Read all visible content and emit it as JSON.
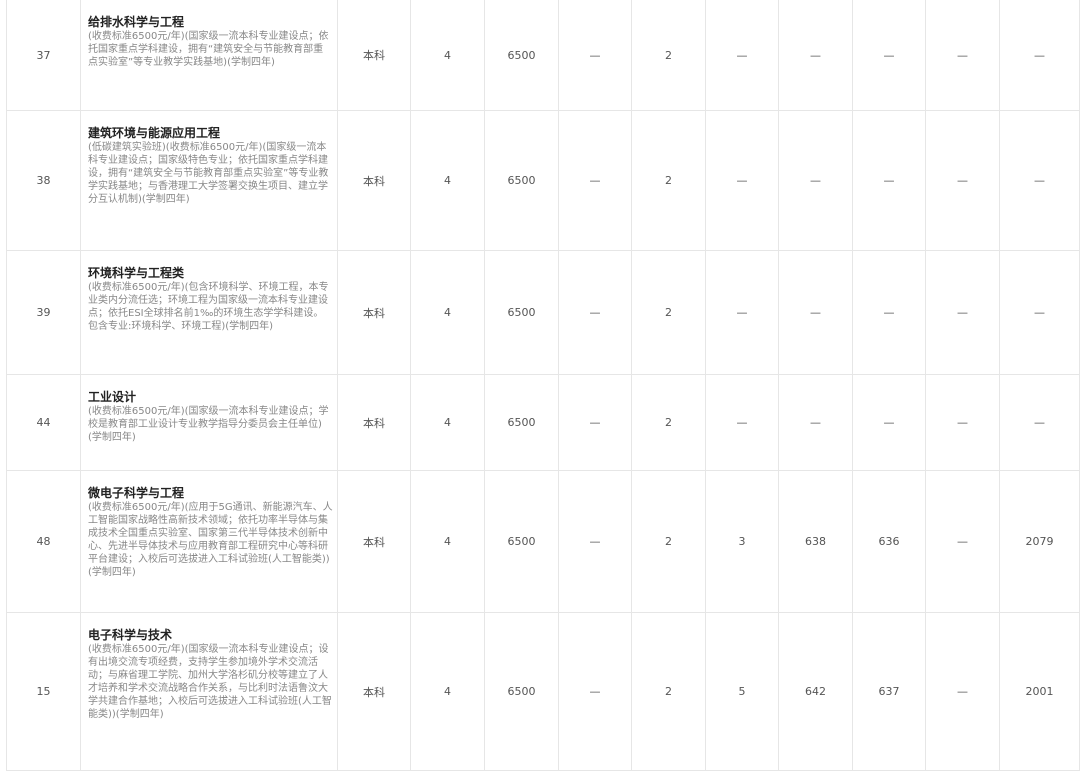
{
  "rows": [
    {
      "code": "37",
      "name": "给排水科学与工程",
      "desc": "(收费标准6500元/年)(国家级一流本科专业建设点；依托国家重点学科建设，拥有“建筑安全与节能教育部重点实验室”等专业教学实践基地)(学制四年)",
      "level": "本科",
      "years": "4",
      "fee": "6500",
      "c1": "—",
      "c2": "2",
      "c3": "—",
      "c4": "—",
      "c5": "—",
      "c6": "—",
      "c7": "—"
    },
    {
      "code": "38",
      "name": "建筑环境与能源应用工程",
      "desc": "(低碳建筑实验班)(收费标准6500元/年)(国家级一流本科专业建设点；国家级特色专业；依托国家重点学科建设，拥有“建筑安全与节能教育部重点实验室”等专业教学实践基地；与香港理工大学签署交换生项目、建立学分互认机制)(学制四年)",
      "level": "本科",
      "years": "4",
      "fee": "6500",
      "c1": "—",
      "c2": "2",
      "c3": "—",
      "c4": "—",
      "c5": "—",
      "c6": "—",
      "c7": "—"
    },
    {
      "code": "39",
      "name": "环境科学与工程类",
      "desc": "(收费标准6500元/年)(包含环境科学、环境工程，本专业类内分流任选；环境工程为国家级一流本科专业建设点；依托ESI全球排名前1‰的环境生态学学科建设。包含专业:环境科学、环境工程)(学制四年)",
      "level": "本科",
      "years": "4",
      "fee": "6500",
      "c1": "—",
      "c2": "2",
      "c3": "—",
      "c4": "—",
      "c5": "—",
      "c6": "—",
      "c7": "—"
    },
    {
      "code": "44",
      "name": "工业设计",
      "desc": "(收费标准6500元/年)(国家级一流本科专业建设点；学校是教育部工业设计专业教学指导分委员会主任单位)(学制四年)",
      "level": "本科",
      "years": "4",
      "fee": "6500",
      "c1": "—",
      "c2": "2",
      "c3": "—",
      "c4": "—",
      "c5": "—",
      "c6": "—",
      "c7": "—"
    },
    {
      "code": "48",
      "name": "微电子科学与工程",
      "desc": "(收费标准6500元/年)(应用于5G通讯、新能源汽车、人工智能国家战略性高新技术领域；依托功率半导体与集成技术全国重点实验室、国家第三代半导体技术创新中心、先进半导体技术与应用教育部工程研究中心等科研平台建设；入校后可选拔进入工科试验班(人工智能类))(学制四年)",
      "level": "本科",
      "years": "4",
      "fee": "6500",
      "c1": "—",
      "c2": "2",
      "c3": "3",
      "c4": "638",
      "c5": "636",
      "c6": "—",
      "c7": "2079"
    },
    {
      "code": "15",
      "name": "电子科学与技术",
      "desc": "(收费标准6500元/年)(国家级一流本科专业建设点；设有出境交流专项经费，支持学生参加境外学术交流活动；与麻省理工学院、加州大学洛杉矶分校等建立了人才培养和学术交流战略合作关系，与比利时法语鲁汶大学共建合作基地；入校后可选拔进入工科试验班(人工智能类))(学制四年)",
      "level": "本科",
      "years": "4",
      "fee": "6500",
      "c1": "—",
      "c2": "2",
      "c3": "5",
      "c4": "642",
      "c5": "637",
      "c6": "—",
      "c7": "2001"
    }
  ]
}
